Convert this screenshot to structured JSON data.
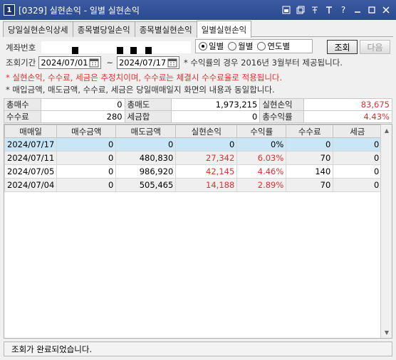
{
  "window": {
    "number": "1",
    "title": "[0329] 실현손익 - 일별 실현손익",
    "icons": [
      "pin-icon",
      "window-icon",
      "tack-icon",
      "text-icon",
      "help-icon",
      "minimize-icon",
      "maximize-icon",
      "close-icon"
    ]
  },
  "tabs": [
    {
      "label": "당일실현손익상세",
      "active": false
    },
    {
      "label": "종목별당일손익",
      "active": false
    },
    {
      "label": "종목별실현손익",
      "active": false
    },
    {
      "label": "일별실현손익",
      "active": true
    }
  ],
  "form": {
    "account_label": "계좌번호",
    "period_label": "조회기간",
    "date_from": "2024/07/01",
    "date_to": "2024/07/17",
    "tilde": "~",
    "period_note": "* 수익률의 경우 2016년 3월부터 제공됩니다.",
    "radios": [
      {
        "label": "일별",
        "checked": true
      },
      {
        "label": "월별",
        "checked": false
      },
      {
        "label": "연도별",
        "checked": false
      }
    ],
    "search_button": "조회",
    "next_button": "다음"
  },
  "notes": {
    "red": "* 실현손익, 수수료, 세금은 추정치이며, 수수료는 체결시 수수료율로 적용됩니다.",
    "normal": "* 매입금액, 매도금액, 수수료, 세금은 당일매매일지 화면의 내용과 동일합니다."
  },
  "summary": {
    "total_buy_label": "총매수",
    "total_buy": "0",
    "total_sell_label": "총매도",
    "total_sell": "1,973,215",
    "realized_label": "실현손익",
    "realized": "83,675",
    "fee_label": "수수료",
    "fee": "280",
    "tax_label": "세금합",
    "tax": "0",
    "total_return_label": "총수익률",
    "total_return": "4.43%"
  },
  "grid": {
    "columns": [
      "매매일",
      "매수금액",
      "매도금액",
      "실현손익",
      "수익률",
      "수수료",
      "세금"
    ],
    "rows": [
      [
        "2024/07/17",
        "0",
        "0",
        "0",
        "0%",
        "0",
        "0"
      ],
      [
        "2024/07/11",
        "0",
        "480,830",
        "27,342",
        "6.03%",
        "70",
        "0"
      ],
      [
        "2024/07/05",
        "0",
        "986,920",
        "42,145",
        "4.46%",
        "140",
        "0"
      ],
      [
        "2024/07/04",
        "0",
        "505,465",
        "14,188",
        "2.89%",
        "70",
        "0"
      ]
    ]
  },
  "status": "조회가 완료되었습니다.",
  "colors": {
    "accent_red": "#e03030",
    "title_bar": "#2c4a8e",
    "selected_row": "#c8e6f5"
  }
}
